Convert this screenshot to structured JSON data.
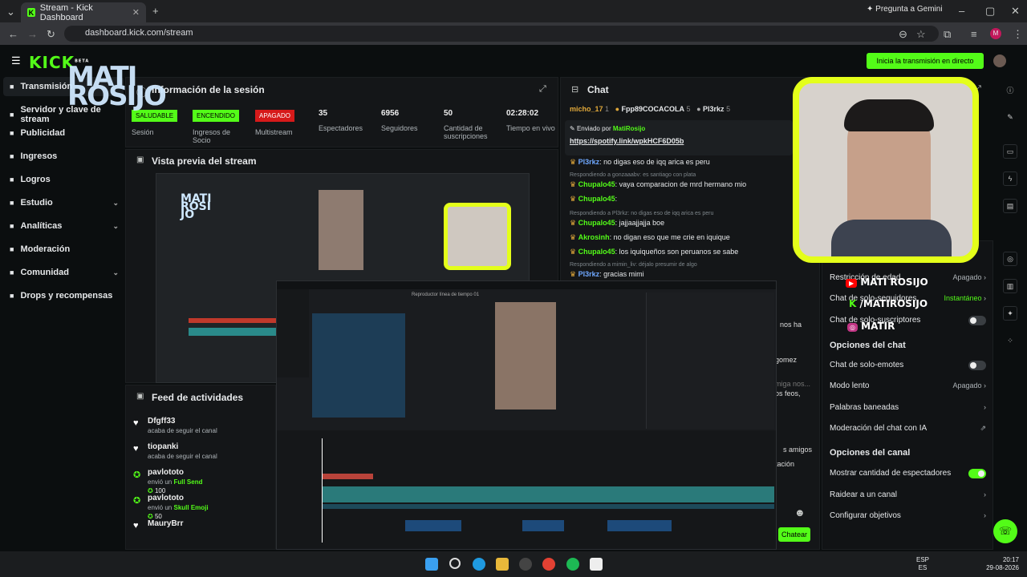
{
  "browser": {
    "tab_title": "Stream - Kick Dashboard",
    "url": "dashboard.kick.com/stream",
    "gemini": "Pregunta a Gemini"
  },
  "header": {
    "logo": "KICK",
    "logo_sup": "BETA",
    "live_button": "Inicia la transmisión en directo"
  },
  "sidebar": {
    "items": [
      {
        "label": "Transmisión",
        "icon": "monitor-icon",
        "chev": false
      },
      {
        "label": "Servidor y clave de stream",
        "icon": "server-icon",
        "chev": false
      },
      {
        "label": "Publicidad",
        "icon": "ad-icon",
        "chev": false
      },
      {
        "label": "Ingresos",
        "icon": "wallet-icon",
        "chev": false
      },
      {
        "label": "Logros",
        "icon": "trophy-icon",
        "chev": false
      },
      {
        "label": "Estudio",
        "icon": "studio-icon",
        "chev": true
      },
      {
        "label": "Analíticas",
        "icon": "chart-icon",
        "chev": true
      },
      {
        "label": "Moderación",
        "icon": "wrench-icon",
        "chev": false
      },
      {
        "label": "Comunidad",
        "icon": "people-icon",
        "chev": true
      },
      {
        "label": "Drops y recompensas",
        "icon": "gift-icon",
        "chev": false
      }
    ]
  },
  "session": {
    "title": "Información de la sesión",
    "stats": [
      {
        "badge": "SALUDABLE",
        "label": "Sesión"
      },
      {
        "badge": "ENCENDIDO",
        "label": "Ingresos de Socio"
      },
      {
        "badge": "APAGADO",
        "label": "Multistream"
      },
      {
        "value": "35",
        "label": "Espectadores"
      },
      {
        "value": "6956",
        "label": "Seguidores"
      },
      {
        "value": "50",
        "label": "Cantidad de suscripciones"
      },
      {
        "value": "02:28:02",
        "label": "Tiempo en vivo"
      }
    ]
  },
  "preview": {
    "title": "Vista previa del stream"
  },
  "feed": {
    "title": "Feed de actividades",
    "items": [
      {
        "user": "Dfgff33",
        "text": "acaba de seguir el canal"
      },
      {
        "user": "tiopanki",
        "text": "acaba de seguir el canal"
      },
      {
        "user": "pavlototo",
        "text": "envió un",
        "gift": "Full Send",
        "amount": "100"
      },
      {
        "user": "pavlototo",
        "text": "envió un",
        "gift": "Skull Emoji",
        "amount": "50"
      },
      {
        "user": "MauryBrr",
        "text": ""
      }
    ]
  },
  "chat": {
    "title": "Chat",
    "top": [
      "micho_17",
      "1",
      "Fpp89COCACOLA",
      "5",
      "Pl3rkz",
      "5"
    ],
    "pinned_label": "Enviado por",
    "pinned_user": "MatiRosijo",
    "pinned_link": "https://spotify.link/wpkHCF6D05b",
    "messages": [
      {
        "user": "Pl3rkz",
        "text": "no digas eso de iqq arica es peru",
        "color": "b"
      },
      {
        "reply": "Respondiendo a gonzaaabv: es santiago con plata"
      },
      {
        "user": "Chupalo45",
        "text": "vaya comparacion de mrd hermano mio",
        "color": "n"
      },
      {
        "user": "Chupalo45",
        "text": "",
        "color": "n"
      },
      {
        "reply": "Respondiendo a Pl3rkz: no digas eso de iqq arica es peru"
      },
      {
        "user": "Chupalo45",
        "text": "jajjaajjajja boe",
        "color": "n"
      },
      {
        "user": "Akrosinh",
        "text": "no digan eso que me crie en iquique",
        "color": "n"
      },
      {
        "user": "Chupalo45",
        "text": "los iquiqueños son peruanos se sabe",
        "color": "n"
      },
      {
        "reply": "Respondiendo a mimin_liv: déjalo presumir de algo"
      },
      {
        "user": "Pl3rkz",
        "text": "gracias mimi",
        "color": "b"
      }
    ],
    "partial": [
      "nos ha",
      "gomez",
      "miga nos...",
      "os feos,",
      "s amigos",
      "tación"
    ],
    "send": "Chatear"
  },
  "settings": {
    "rows1": [
      {
        "label": "Restricción de edad",
        "value": "Apagado"
      },
      {
        "label": "Chat de solo-seguidores",
        "value": "Instantáneo"
      },
      {
        "label": "Chat de solo-suscriptores",
        "toggle": false
      }
    ],
    "chat_opts_title": "Opciones del chat",
    "rows2": [
      {
        "label": "Chat de solo-emotes",
        "toggle": false
      },
      {
        "label": "Modo lento",
        "value": "Apagado"
      },
      {
        "label": "Palabras baneadas",
        "value": ""
      },
      {
        "label": "Moderación del chat con IA",
        "value": ""
      }
    ],
    "channel_title": "Opciones del canal",
    "rows3": [
      {
        "label": "Mostrar cantidad de espectadores",
        "toggle": true
      },
      {
        "label": "Raidear a un canal",
        "value": ""
      },
      {
        "label": "Configurar objetivos",
        "value": ""
      }
    ]
  },
  "overlay": {
    "yt": "MATI ROSIJO",
    "kick": "/MATIROSIJO",
    "ig": "MATIR",
    "wm": "MATI ROSIJO"
  },
  "editor": {
    "title": "Reproductor línea de tiempo 01"
  },
  "taskbar": {
    "lang": "ESP",
    "lang2": "ES",
    "time": "20:17",
    "date": "29-08-2026"
  },
  "colors": {
    "kick_green": "#53fc18",
    "frame_yellow": "#e4ff1a"
  }
}
